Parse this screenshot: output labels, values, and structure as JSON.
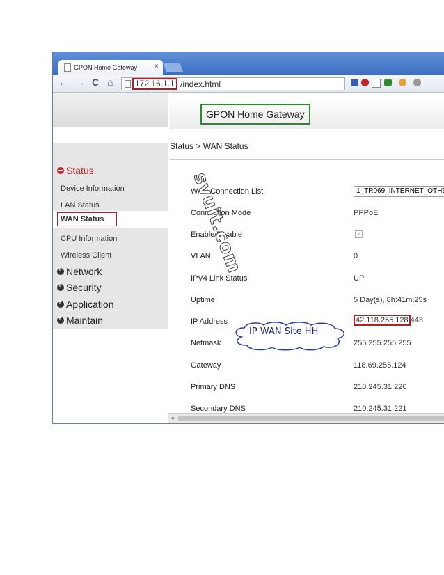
{
  "browser": {
    "tab_title": "GPON Home Gateway",
    "tab_close": "×",
    "url_host": "172.16.1.1",
    "url_path": "/index.html",
    "nav_back": "←",
    "nav_forward": "→",
    "nav_reload": "C",
    "nav_home": "⌂"
  },
  "header": {
    "brand": "GPON Home Gateway"
  },
  "breadcrumb": "Status > WAN Status",
  "sidebar": {
    "status_heading": "Status",
    "status_items": [
      "Device Information",
      "LAN Status",
      "WAN Status",
      "CPU Information",
      "Wireless Client"
    ],
    "sections": [
      "Network",
      "Security",
      "Application",
      "Maintain"
    ]
  },
  "wan": {
    "rows": [
      {
        "label": "WAN Connection List",
        "value": "1_TR069_INTERNET_OTHE"
      },
      {
        "label": "Connection Mode",
        "value": "PPPoE"
      },
      {
        "label": "Enable/Disable",
        "value": "✓"
      },
      {
        "label": "VLAN",
        "value": "0"
      },
      {
        "label": "IPV4 Link Status",
        "value": "UP"
      },
      {
        "label": "Uptime",
        "value": "5 Day(s), 8h:41m:25s"
      },
      {
        "label": "IP Address",
        "value": "42.118.255.128",
        "value_suffix": "443"
      },
      {
        "label": "Netmask",
        "value": "255.255.255.255"
      },
      {
        "label": "Gateway",
        "value": "118.69.255.124"
      },
      {
        "label": "Primary DNS",
        "value": "210.245.31.220"
      },
      {
        "label": "Secondary DNS",
        "value": "210.245.31.221"
      }
    ]
  },
  "annotation": {
    "callout": "IP WAN Site HH",
    "watermark": "svuit.com"
  },
  "colors": {
    "highlight_red": "#b32020",
    "highlight_green": "#2f8a2f",
    "status_red": "#c0272d"
  }
}
